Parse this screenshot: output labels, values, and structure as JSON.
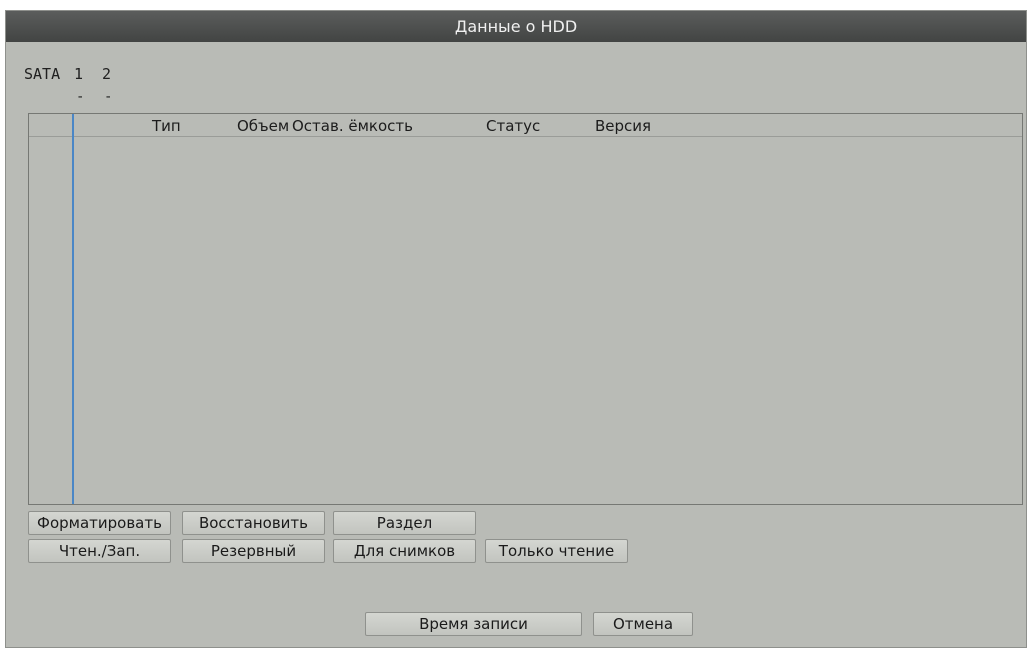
{
  "window": {
    "title": "Данные о HDD"
  },
  "sata": {
    "label": "SATA",
    "ports": [
      "1",
      "2"
    ],
    "port_states": [
      "-",
      "-"
    ]
  },
  "table": {
    "columns": {
      "type": "Тип",
      "volume": "Объем",
      "remaining": "Остав. ёмкость",
      "status": "Статус",
      "version": "Версия"
    },
    "rows": []
  },
  "buttons": {
    "format": "Форматировать",
    "restore": "Восстановить",
    "partition": "Раздел",
    "read_write": "Чтен./Зап.",
    "redundant": "Резервный",
    "snapshots": "Для снимков",
    "read_only": "Только чтение",
    "record_time": "Время записи",
    "cancel": "Отмена"
  }
}
